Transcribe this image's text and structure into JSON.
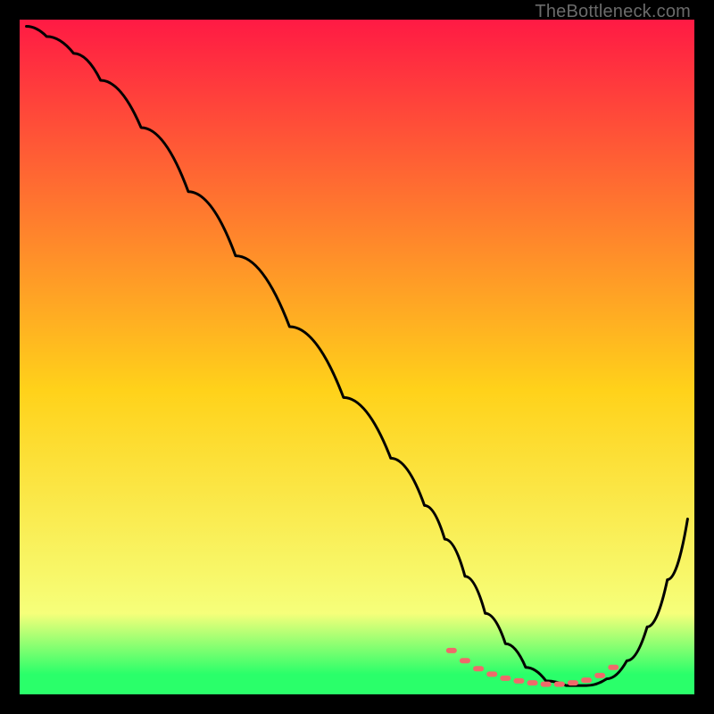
{
  "watermark": "TheBottleneck.com",
  "colors": {
    "top": "#ff1a44",
    "mid": "#ffd21a",
    "green": "#2aff6a",
    "line": "#000000",
    "dot": "#ef6a6a",
    "bg": "#000000"
  },
  "chart_data": {
    "type": "line",
    "title": "",
    "xlabel": "",
    "ylabel": "",
    "xlim": [
      0,
      100
    ],
    "ylim": [
      0,
      100
    ],
    "grid": false,
    "legend": false,
    "series": [
      {
        "name": "curve",
        "x": [
          1,
          4,
          8,
          12,
          18,
          25,
          32,
          40,
          48,
          55,
          60,
          63,
          66,
          69,
          72,
          75,
          78,
          81,
          84,
          87,
          90,
          93,
          96,
          99
        ],
        "y": [
          99,
          97.5,
          95,
          91,
          84,
          74.5,
          65,
          54.5,
          44,
          35,
          28,
          23,
          17.5,
          12,
          7.5,
          4,
          2,
          1.3,
          1.3,
          2.3,
          5,
          10,
          17,
          26
        ]
      }
    ],
    "dots": {
      "name": "bottom-dots",
      "x": [
        64,
        66,
        68,
        70,
        72,
        74,
        76,
        78,
        80,
        82,
        84,
        86,
        88
      ],
      "y": [
        6.5,
        5,
        3.8,
        3,
        2.4,
        2,
        1.7,
        1.5,
        1.5,
        1.7,
        2.1,
        2.8,
        4
      ]
    }
  }
}
